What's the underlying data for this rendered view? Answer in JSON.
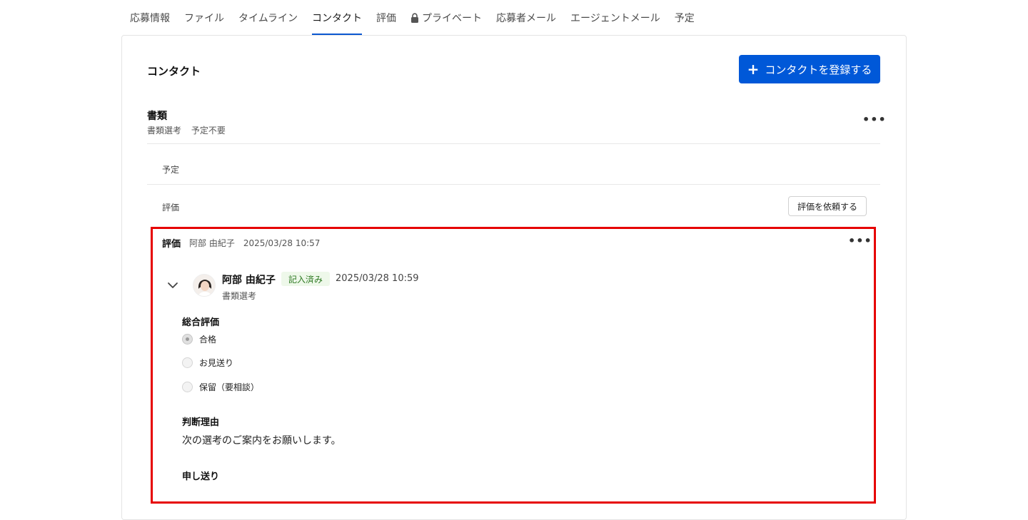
{
  "tabs": [
    {
      "label": "応募情報",
      "active": false
    },
    {
      "label": "ファイル",
      "active": false
    },
    {
      "label": "タイムライン",
      "active": false
    },
    {
      "label": "コンタクト",
      "active": true
    },
    {
      "label": "評価",
      "active": false
    },
    {
      "label": "プライベート",
      "active": false,
      "icon": "lock-icon"
    },
    {
      "label": "応募者メール",
      "active": false
    },
    {
      "label": "エージェントメール",
      "active": false
    },
    {
      "label": "予定",
      "active": false
    }
  ],
  "contact": {
    "title": "コンタクト",
    "register_button": "コンタクトを登録する",
    "accent_color": "#0058d8"
  },
  "document": {
    "title": "書類",
    "stage": "書類選考",
    "schedule_status": "予定不要"
  },
  "rows": {
    "schedule_label": "予定",
    "evaluation_label": "評価",
    "request_button": "評価を依頼する"
  },
  "evaluation": {
    "label": "評価",
    "requester": "阿部 由紀子",
    "requested_at": "2025/03/28 10:57",
    "highlight_color": "#e60000",
    "reviewer": {
      "name": "阿部 由紀子",
      "status": "記入済み",
      "submitted_at": "2025/03/28 10:59",
      "stage": "書類選考"
    },
    "overall": {
      "title": "総合評価",
      "options": [
        {
          "label": "合格",
          "selected": true
        },
        {
          "label": "お見送り",
          "selected": false
        },
        {
          "label": "保留（要相談）",
          "selected": false
        }
      ]
    },
    "reason": {
      "title": "判断理由",
      "text": "次の選考のご案内をお願いします。"
    },
    "handover": {
      "title": "申し送り"
    }
  }
}
